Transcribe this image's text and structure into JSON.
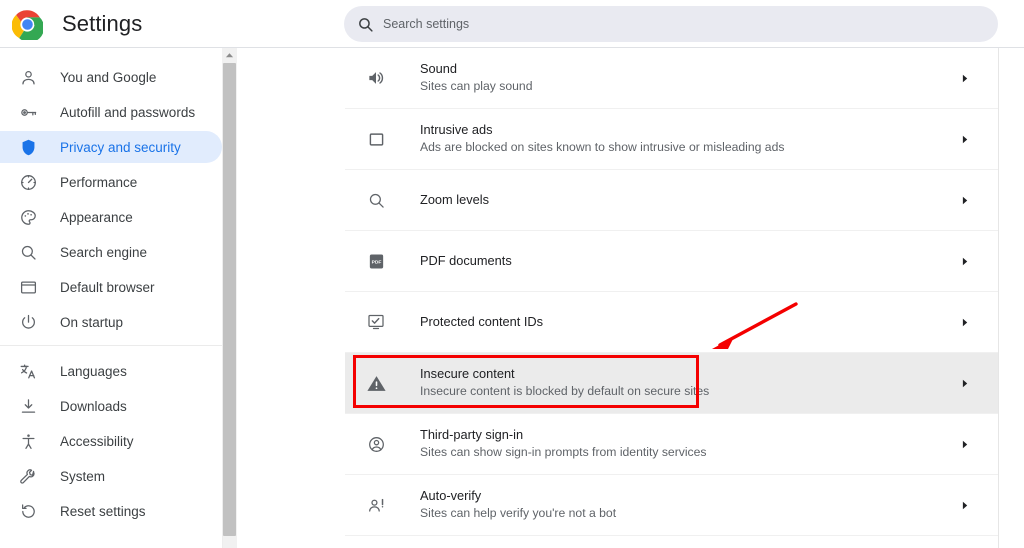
{
  "header": {
    "logo_icon": "chrome-logo-icon",
    "title": "Settings",
    "search": {
      "icon": "search-icon",
      "placeholder": "Search settings",
      "value": ""
    }
  },
  "sidebar": {
    "scrollbar": {
      "up_arrow_icon": "scroll-up-arrow-icon"
    },
    "groups": [
      {
        "items": [
          {
            "icon": "person-icon",
            "label": "You and Google",
            "selected": false
          },
          {
            "icon": "key-icon",
            "label": "Autofill and passwords",
            "selected": false
          },
          {
            "icon": "shield-icon",
            "label": "Privacy and security",
            "selected": true
          },
          {
            "icon": "speed-icon",
            "label": "Performance",
            "selected": false
          },
          {
            "icon": "palette-icon",
            "label": "Appearance",
            "selected": false
          },
          {
            "icon": "search-icon",
            "label": "Search engine",
            "selected": false
          },
          {
            "icon": "browser-icon",
            "label": "Default browser",
            "selected": false
          },
          {
            "icon": "power-icon",
            "label": "On startup",
            "selected": false
          }
        ]
      },
      {
        "items": [
          {
            "icon": "translate-icon",
            "label": "Languages",
            "selected": false
          },
          {
            "icon": "download-icon",
            "label": "Downloads",
            "selected": false
          },
          {
            "icon": "accessibility-icon",
            "label": "Accessibility",
            "selected": false
          },
          {
            "icon": "wrench-icon",
            "label": "System",
            "selected": false
          },
          {
            "icon": "reset-icon",
            "label": "Reset settings",
            "selected": false
          }
        ]
      }
    ],
    "selected_accent": "#1a73e8",
    "selected_background": "#e1ecfd"
  },
  "main": {
    "rows": [
      {
        "icon": "sound-icon",
        "title": "Sound",
        "subtitle": "Sites can play sound",
        "chevron": "chevron-right-icon",
        "highlighted": false
      },
      {
        "icon": "intrusive-ads-icon",
        "title": "Intrusive ads",
        "subtitle": "Ads are blocked on sites known to show intrusive or misleading ads",
        "chevron": "chevron-right-icon",
        "highlighted": false
      },
      {
        "icon": "zoom-icon",
        "title": "Zoom levels",
        "subtitle": "",
        "chevron": "chevron-right-icon",
        "highlighted": false
      },
      {
        "icon": "pdf-icon",
        "title": "PDF documents",
        "subtitle": "",
        "chevron": "chevron-right-icon",
        "highlighted": false
      },
      {
        "icon": "protected-content-icon",
        "title": "Protected content IDs",
        "subtitle": "",
        "chevron": "chevron-right-icon",
        "highlighted": false
      },
      {
        "icon": "warning-icon",
        "title": "Insecure content",
        "subtitle": "Insecure content is blocked by default on secure sites",
        "chevron": "chevron-right-icon",
        "highlighted": true
      },
      {
        "icon": "account-circle-icon",
        "title": "Third-party sign-in",
        "subtitle": "Sites can show sign-in prompts from identity services",
        "chevron": "chevron-right-icon",
        "highlighted": false
      },
      {
        "icon": "auto-verify-icon",
        "title": "Auto-verify",
        "subtitle": "Sites can help verify you're not a bot",
        "chevron": "chevron-right-icon",
        "highlighted": false
      }
    ]
  },
  "annotations": {
    "highlight_box": {
      "name": "red-highlight-box",
      "color": "#f40000",
      "target": "Insecure content"
    },
    "pointer_arrow": {
      "name": "red-pointer-arrow",
      "color": "#f40000",
      "direction": "down-left"
    }
  }
}
